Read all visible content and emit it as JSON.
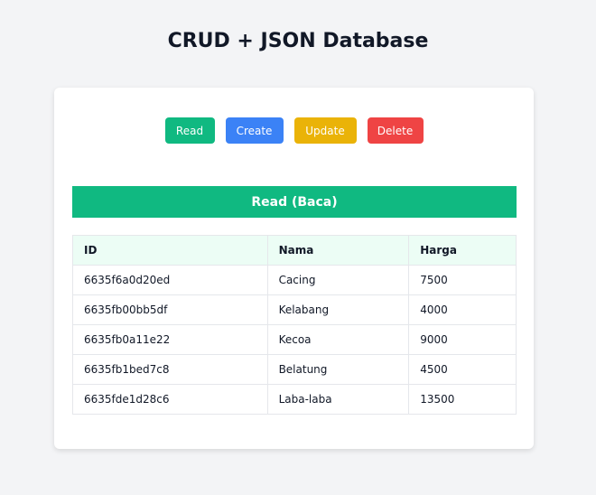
{
  "page": {
    "title": "CRUD + JSON Database"
  },
  "toolbar": {
    "read_label": "Read",
    "create_label": "Create",
    "update_label": "Update",
    "delete_label": "Delete"
  },
  "section": {
    "title": "Read (Baca)"
  },
  "table": {
    "headers": [
      "ID",
      "Nama",
      "Harga"
    ],
    "rows": [
      [
        "6635f6a0d20ed",
        "Cacing",
        "7500"
      ],
      [
        "6635fb00bb5df",
        "Kelabang",
        "4000"
      ],
      [
        "6635fb0a11e22",
        "Kecoa",
        "9000"
      ],
      [
        "6635fb1bed7c8",
        "Belatung",
        "4500"
      ],
      [
        "6635fde1d28c6",
        "Laba-laba",
        "13500"
      ]
    ]
  },
  "colors": {
    "read": "#10b981",
    "create": "#3b82f6",
    "update": "#eab308",
    "delete": "#ef4444",
    "table_header_bg": "#ecfdf5"
  }
}
